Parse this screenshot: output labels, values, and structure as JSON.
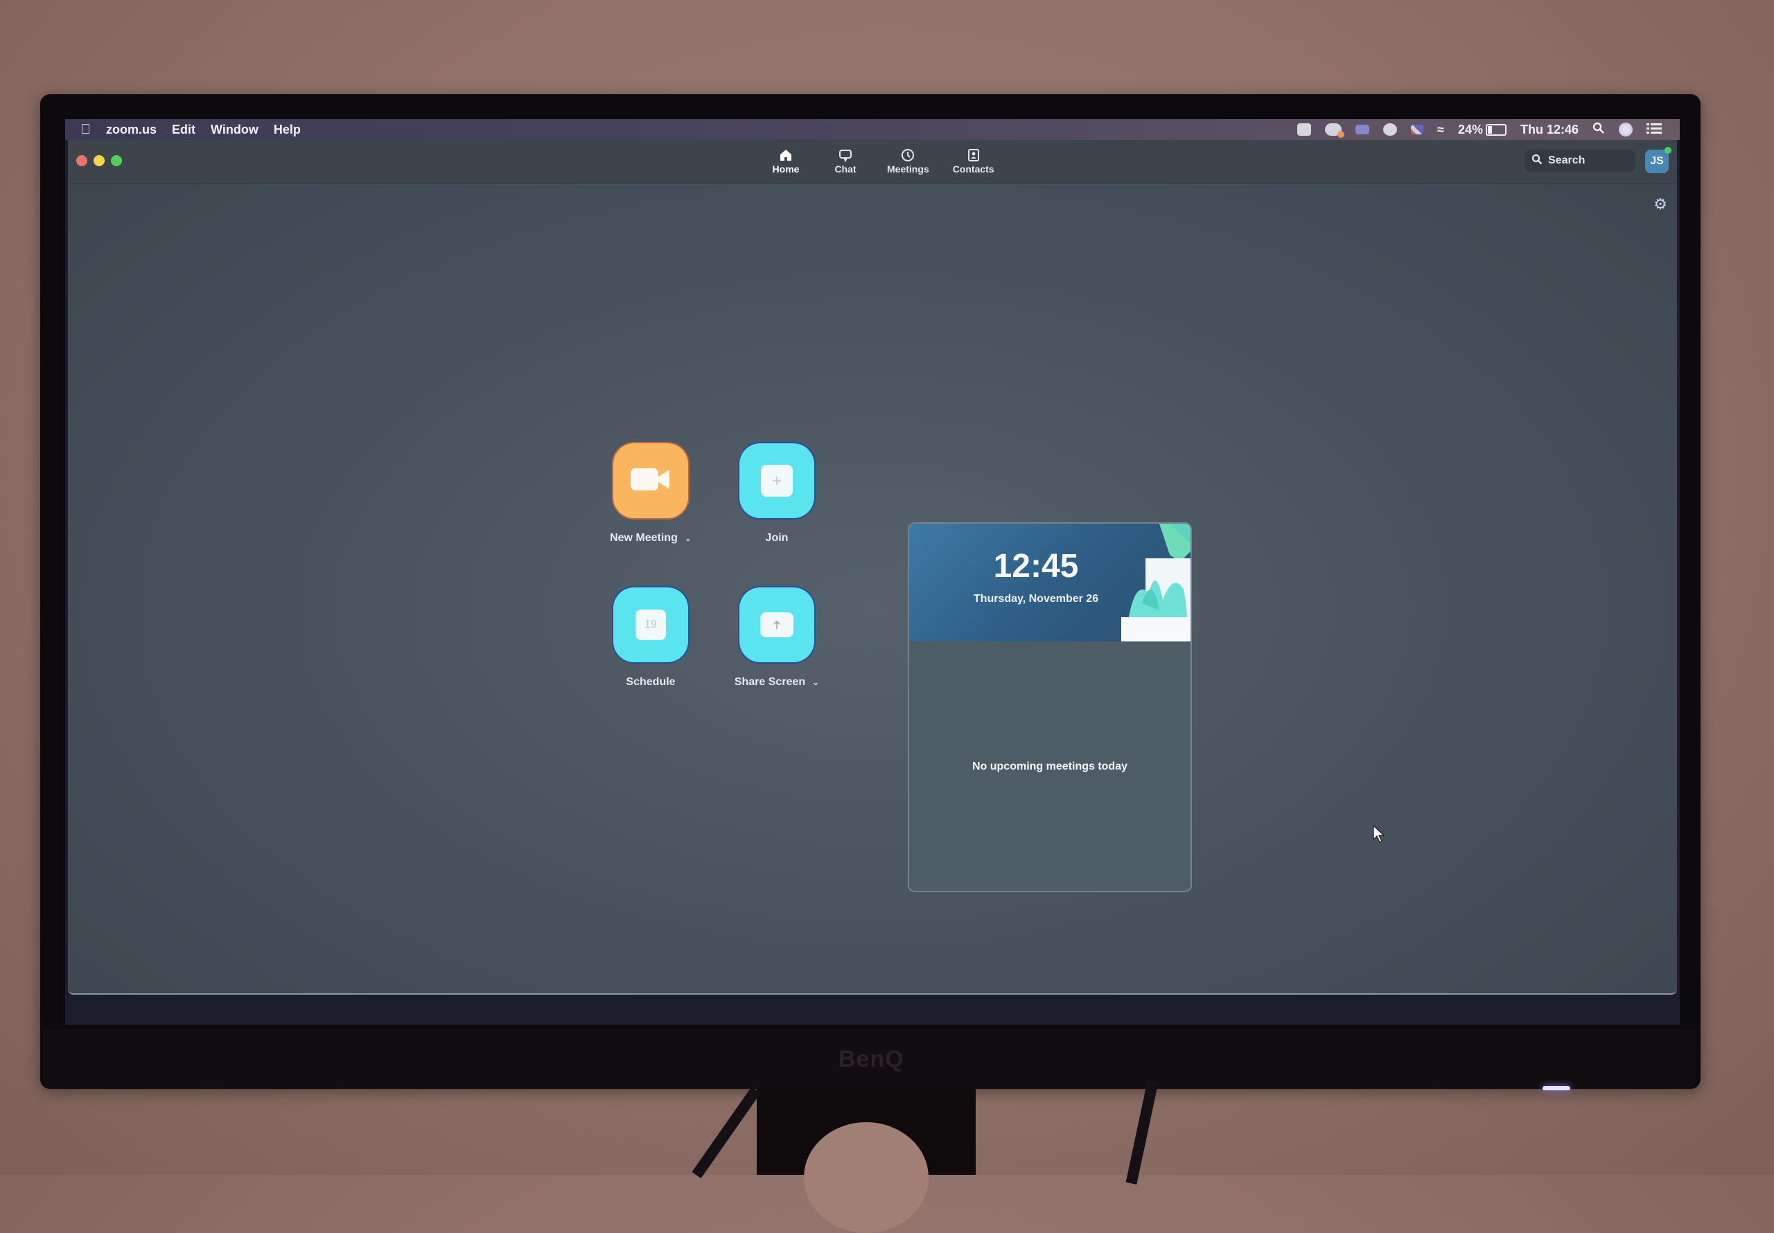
{
  "menubar": {
    "app_name": "zoom.us",
    "menus": [
      "Edit",
      "Window",
      "Help"
    ],
    "status": {
      "battery_percent": "24%",
      "clock": "Thu 12:46",
      "icons": [
        "screen-record-icon",
        "cloud-icon",
        "chart-icon",
        "disc-icon",
        "flag-icon",
        "wifi-icon",
        "battery-icon",
        "spotlight-icon",
        "siri-icon",
        "control-center-icon"
      ]
    }
  },
  "window": {
    "tabs": [
      {
        "id": "home",
        "label": "Home",
        "icon": "home-icon",
        "active": true
      },
      {
        "id": "chat",
        "label": "Chat",
        "icon": "chat-bubble-icon",
        "active": false
      },
      {
        "id": "meetings",
        "label": "Meetings",
        "icon": "clock-icon",
        "active": false
      },
      {
        "id": "contacts",
        "label": "Contacts",
        "icon": "contact-card-icon",
        "active": false
      }
    ],
    "search": {
      "placeholder": "Search"
    },
    "user": {
      "initials": "JS",
      "status": "online",
      "status_color": "#3ed06a"
    }
  },
  "actions": [
    {
      "id": "new-meeting",
      "label": "New Meeting",
      "has_dropdown": true,
      "color": "#f9b65e",
      "icon": "video-camera-icon"
    },
    {
      "id": "join",
      "label": "Join",
      "has_dropdown": false,
      "color": "#59e4f0",
      "icon": "plus-icon"
    },
    {
      "id": "schedule",
      "label": "Schedule",
      "has_dropdown": false,
      "color": "#59e4f0",
      "icon": "calendar-icon",
      "calendar_day": "19"
    },
    {
      "id": "share-screen",
      "label": "Share Screen",
      "has_dropdown": true,
      "color": "#59e4f0",
      "icon": "share-up-arrow-icon"
    }
  ],
  "meeting_card": {
    "time": "12:45",
    "date": "Thursday, November 26",
    "empty_message": "No upcoming meetings today"
  },
  "monitor": {
    "brand": "BenQ"
  }
}
